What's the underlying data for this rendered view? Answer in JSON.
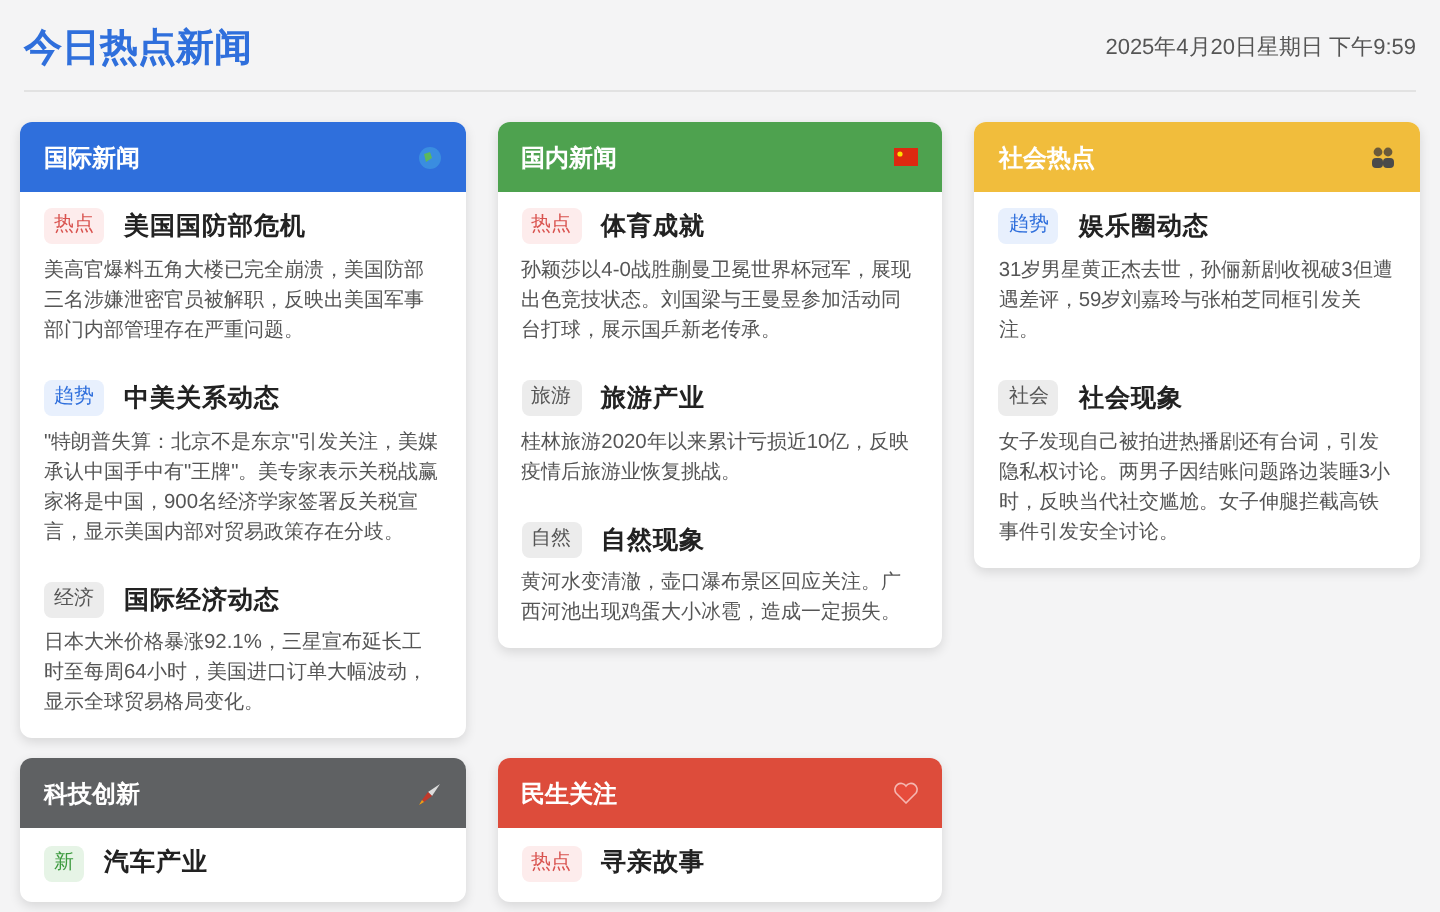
{
  "header": {
    "title": "今日热点新闻",
    "datetime": "2025年4月20日星期日 下午9:59"
  },
  "cards": [
    {
      "title": "国际新闻",
      "color": "#2f6fdc",
      "items": [
        {
          "tag": "热点",
          "kind": "hot",
          "title": "美国国防部危机",
          "text": "美高官爆料五角大楼已完全崩溃，美国防部三名涉嫌泄密官员被解职，反映出美国军事部门内部管理存在严重问题。"
        },
        {
          "tag": "趋势",
          "kind": "trend",
          "title": "中美关系动态",
          "text": "\"特朗普失算：北京不是东京\"引发关注，美媒承认中国手中有\"王牌\"。美专家表示关税战赢家将是中国，900名经济学家签署反关税宣言，显示美国内部对贸易政策存在分歧。"
        },
        {
          "tag": "经济",
          "kind": "neutral",
          "title": "国际经济动态",
          "text": "日本大米价格暴涨92.1%，三星宣布延长工时至每周64小时，美国进口订单大幅波动，显示全球贸易格局变化。"
        }
      ]
    },
    {
      "title": "国内新闻",
      "color": "#4ea24f",
      "items": [
        {
          "tag": "热点",
          "kind": "hot",
          "title": "体育成就",
          "text": "孙颖莎以4-0战胜蒯曼卫冕世界杯冠军，展现出色竞技状态。刘国梁与王曼昱参加活动同台打球，展示国乒新老传承。"
        },
        {
          "tag": "旅游",
          "kind": "neutral",
          "title": "旅游产业",
          "text": "桂林旅游2020年以来累计亏损近10亿，反映疫情后旅游业恢复挑战。"
        },
        {
          "tag": "自然",
          "kind": "neutral",
          "title": "自然现象",
          "text": "黄河水变清澈，壶口瀑布景区回应关注。广西河池出现鸡蛋大小冰雹，造成一定损失。"
        }
      ]
    },
    {
      "title": "社会热点",
      "color": "#f1bd3c",
      "items": [
        {
          "tag": "趋势",
          "kind": "trend",
          "title": "娱乐圈动态",
          "text": "31岁男星黄正杰去世，孙俪新剧收视破3但遭遇差评，59岁刘嘉玲与张柏芝同框引发关注。"
        },
        {
          "tag": "社会",
          "kind": "neutral",
          "title": "社会现象",
          "text": "女子发现自己被拍进热播剧还有台词，引发隐私权讨论。两男子因结账问题路边装睡3小时，反映当代社交尴尬。女子伸腿拦截高铁事件引发安全讨论。"
        }
      ]
    },
    {
      "title": "科技创新",
      "color": "#5f6163",
      "items": [
        {
          "tag": "新",
          "kind": "new",
          "title": "汽车产业"
        }
      ]
    },
    {
      "title": "民生关注",
      "color": "#dd4c3b",
      "items": [
        {
          "tag": "热点",
          "kind": "hot",
          "title": "寻亲故事"
        }
      ]
    }
  ]
}
